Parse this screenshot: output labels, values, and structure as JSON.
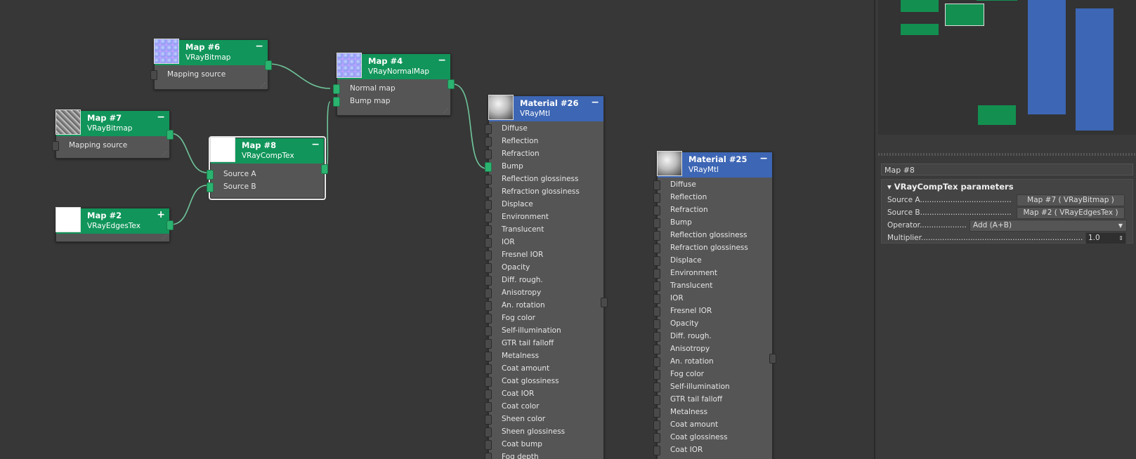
{
  "colors": {
    "map_header": "#11955a",
    "material_header": "#3d66b4",
    "canvas": "#373737",
    "wire": "#6fc49a"
  },
  "nodes": {
    "map6": {
      "title": "Map #6",
      "type": "VRayBitmap",
      "toggle": "−",
      "slots": [
        "Mapping source"
      ]
    },
    "map4": {
      "title": "Map #4",
      "type": "VRayNormalMap",
      "toggle": "−",
      "slots": [
        "Normal map",
        "Bump map"
      ]
    },
    "map7": {
      "title": "Map #7",
      "type": "VRayBitmap",
      "toggle": "−",
      "slots": [
        "Mapping source"
      ]
    },
    "map8": {
      "title": "Map #8",
      "type": "VRayCompTex",
      "toggle": "−",
      "slots": [
        "Source A",
        "Source B"
      ]
    },
    "map2": {
      "title": "Map #2",
      "type": "VRayEdgesTex",
      "toggle": "+"
    },
    "mat26": {
      "title": "Material #26",
      "type": "VRayMtl",
      "toggle": "−",
      "slots": [
        "Diffuse",
        "Reflection",
        "Refraction",
        "Bump",
        "Reflection glossiness",
        "Refraction glossiness",
        "Displace",
        "Environment",
        "Translucent",
        "IOR",
        "Fresnel IOR",
        "Opacity",
        "Diff. rough.",
        "Anisotropy",
        "An. rotation",
        "Fog color",
        "Self-illumination",
        "GTR tail falloff",
        "Metalness",
        "Coat amount",
        "Coat glossiness",
        "Coat IOR",
        "Coat color",
        "Sheen color",
        "Sheen glossiness",
        "Coat bump",
        "Fog depth"
      ]
    },
    "mat25": {
      "title": "Material #25",
      "type": "VRayMtl",
      "toggle": "−",
      "slots": [
        "Diffuse",
        "Reflection",
        "Refraction",
        "Bump",
        "Reflection glossiness",
        "Refraction glossiness",
        "Displace",
        "Environment",
        "Translucent",
        "IOR",
        "Fresnel IOR",
        "Opacity",
        "Diff. rough.",
        "Anisotropy",
        "An. rotation",
        "Fog color",
        "Self-illumination",
        "GTR tail falloff",
        "Metalness",
        "Coat amount",
        "Coat glossiness",
        "Coat IOR"
      ]
    }
  },
  "panel": {
    "title": "Map #8",
    "rollout": "VRayCompTex parameters",
    "params": [
      {
        "label": "Source A.......................................",
        "value": "Map #7  ( VRayBitmap )"
      },
      {
        "label": "Source B.......................................",
        "value": "Map #2  ( VRayEdgesTex )"
      },
      {
        "label": "Operator....................",
        "value": "Add (A+B)"
      },
      {
        "label": "Multiplier.................................................................................",
        "value": "1.0"
      }
    ]
  }
}
